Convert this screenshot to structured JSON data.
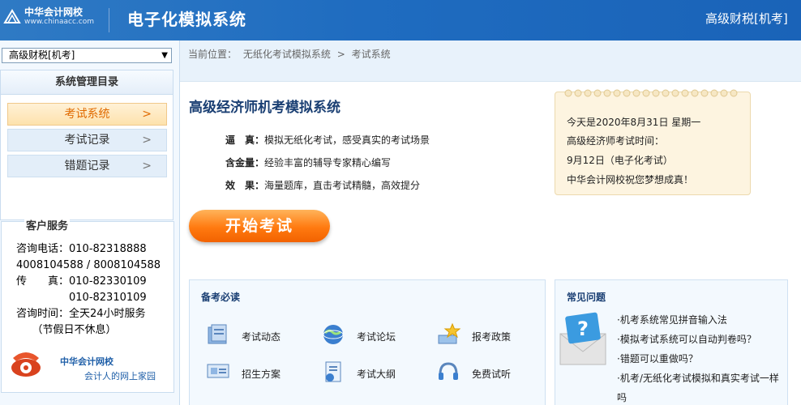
{
  "header": {
    "logo_cn": "中华会计网校",
    "logo_en": "www.chinaacc.com",
    "system_title": "电子化模拟系统",
    "exam_label": "高级财税[机考]"
  },
  "sidebar": {
    "exam_select_value": "高级财税[机考]",
    "menu_title": "系统管理目录",
    "items": [
      {
        "label": "考试系统",
        "active": true
      },
      {
        "label": "考试记录",
        "active": false
      },
      {
        "label": "错题记录",
        "active": false
      }
    ],
    "customer_service": {
      "title": "客户服务",
      "lines": [
        "咨询电话：010-82318888",
        "4008104588 / 8008104588",
        "传　　真：010-82330109",
        "　　　　　010-82310109",
        "咨询时间：全天24小时服务",
        "　　（节假日不休息）"
      ],
      "brand": "中华会计网校",
      "slogan": "会计人的网上家园"
    }
  },
  "breadcrumb": {
    "prefix": "当前位置：",
    "items": [
      "无纸化考试模拟系统",
      "考试系统"
    ],
    "separator": ">"
  },
  "main": {
    "title": "高级经济师机考模拟系统",
    "features": [
      {
        "label": "逼　真：",
        "text": "模拟无纸化考试，感受真实的考试场景"
      },
      {
        "label": "含金量：",
        "text": "经验丰富的辅导专家精心编写"
      },
      {
        "label": "效　果：",
        "text": "海量题库，直击考试精髓，高效提分"
      }
    ],
    "start_button": "开始考试",
    "notice": [
      "今天是2020年8月31日 星期一",
      "高级经济师考试时间：",
      "9月12日（电子化考试）",
      "中华会计网校祝您梦想成真！"
    ]
  },
  "prep": {
    "title": "备考必读",
    "items": [
      {
        "label": "考试动态",
        "icon": "news-icon"
      },
      {
        "label": "考试论坛",
        "icon": "globe-icon"
      },
      {
        "label": "报考政策",
        "icon": "star-stack-icon"
      },
      {
        "label": "招生方案",
        "icon": "certificate-icon"
      },
      {
        "label": "考试大纲",
        "icon": "document-icon"
      },
      {
        "label": "免费试听",
        "icon": "headset-icon"
      }
    ]
  },
  "faq": {
    "title": "常见问题",
    "items": [
      "·机考系统常见拼音输入法",
      "·模拟考试系统可以自动判卷吗？",
      "·错题可以重做吗？",
      "·机考/无纸化考试模拟和真实考试一样吗"
    ]
  },
  "colors": {
    "header_blue": "#1f6cc0",
    "accent_orange": "#ff7a10",
    "title_navy": "#1a3f73"
  }
}
